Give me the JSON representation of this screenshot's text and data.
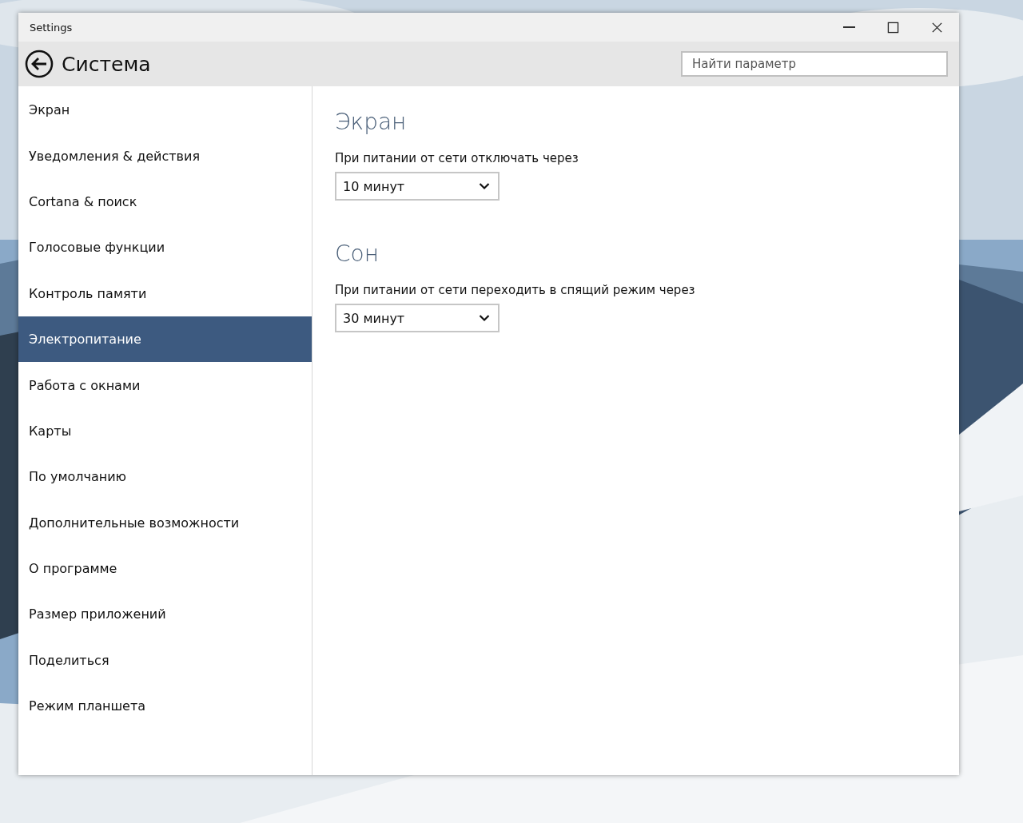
{
  "window": {
    "title": "Settings"
  },
  "header": {
    "title": "Система",
    "search": {
      "placeholder": "Найти параметр"
    }
  },
  "sidebar": {
    "items": [
      {
        "label": "Экран",
        "selected": false
      },
      {
        "label": "Уведомления & действия",
        "selected": false
      },
      {
        "label": "Cortana & поиск",
        "selected": false
      },
      {
        "label": "Голосовые функции",
        "selected": false
      },
      {
        "label": "Контроль памяти",
        "selected": false
      },
      {
        "label": "Электропитание",
        "selected": true
      },
      {
        "label": "Работа с окнами",
        "selected": false
      },
      {
        "label": "Карты",
        "selected": false
      },
      {
        "label": "По умолчанию",
        "selected": false
      },
      {
        "label": "Дополнительные возможности",
        "selected": false
      },
      {
        "label": "О программе",
        "selected": false
      },
      {
        "label": "Размер приложений",
        "selected": false
      },
      {
        "label": "Поделиться",
        "selected": false
      },
      {
        "label": "Режим планшета",
        "selected": false
      }
    ]
  },
  "content": {
    "sections": [
      {
        "heading": "Экран",
        "label": "При питании от сети отключать через",
        "dropdown": {
          "value": "10 минут"
        }
      },
      {
        "heading": "Сон",
        "label": "При питании от сети переходить в спящий режим через",
        "dropdown": {
          "value": "30 минут"
        }
      }
    ]
  }
}
